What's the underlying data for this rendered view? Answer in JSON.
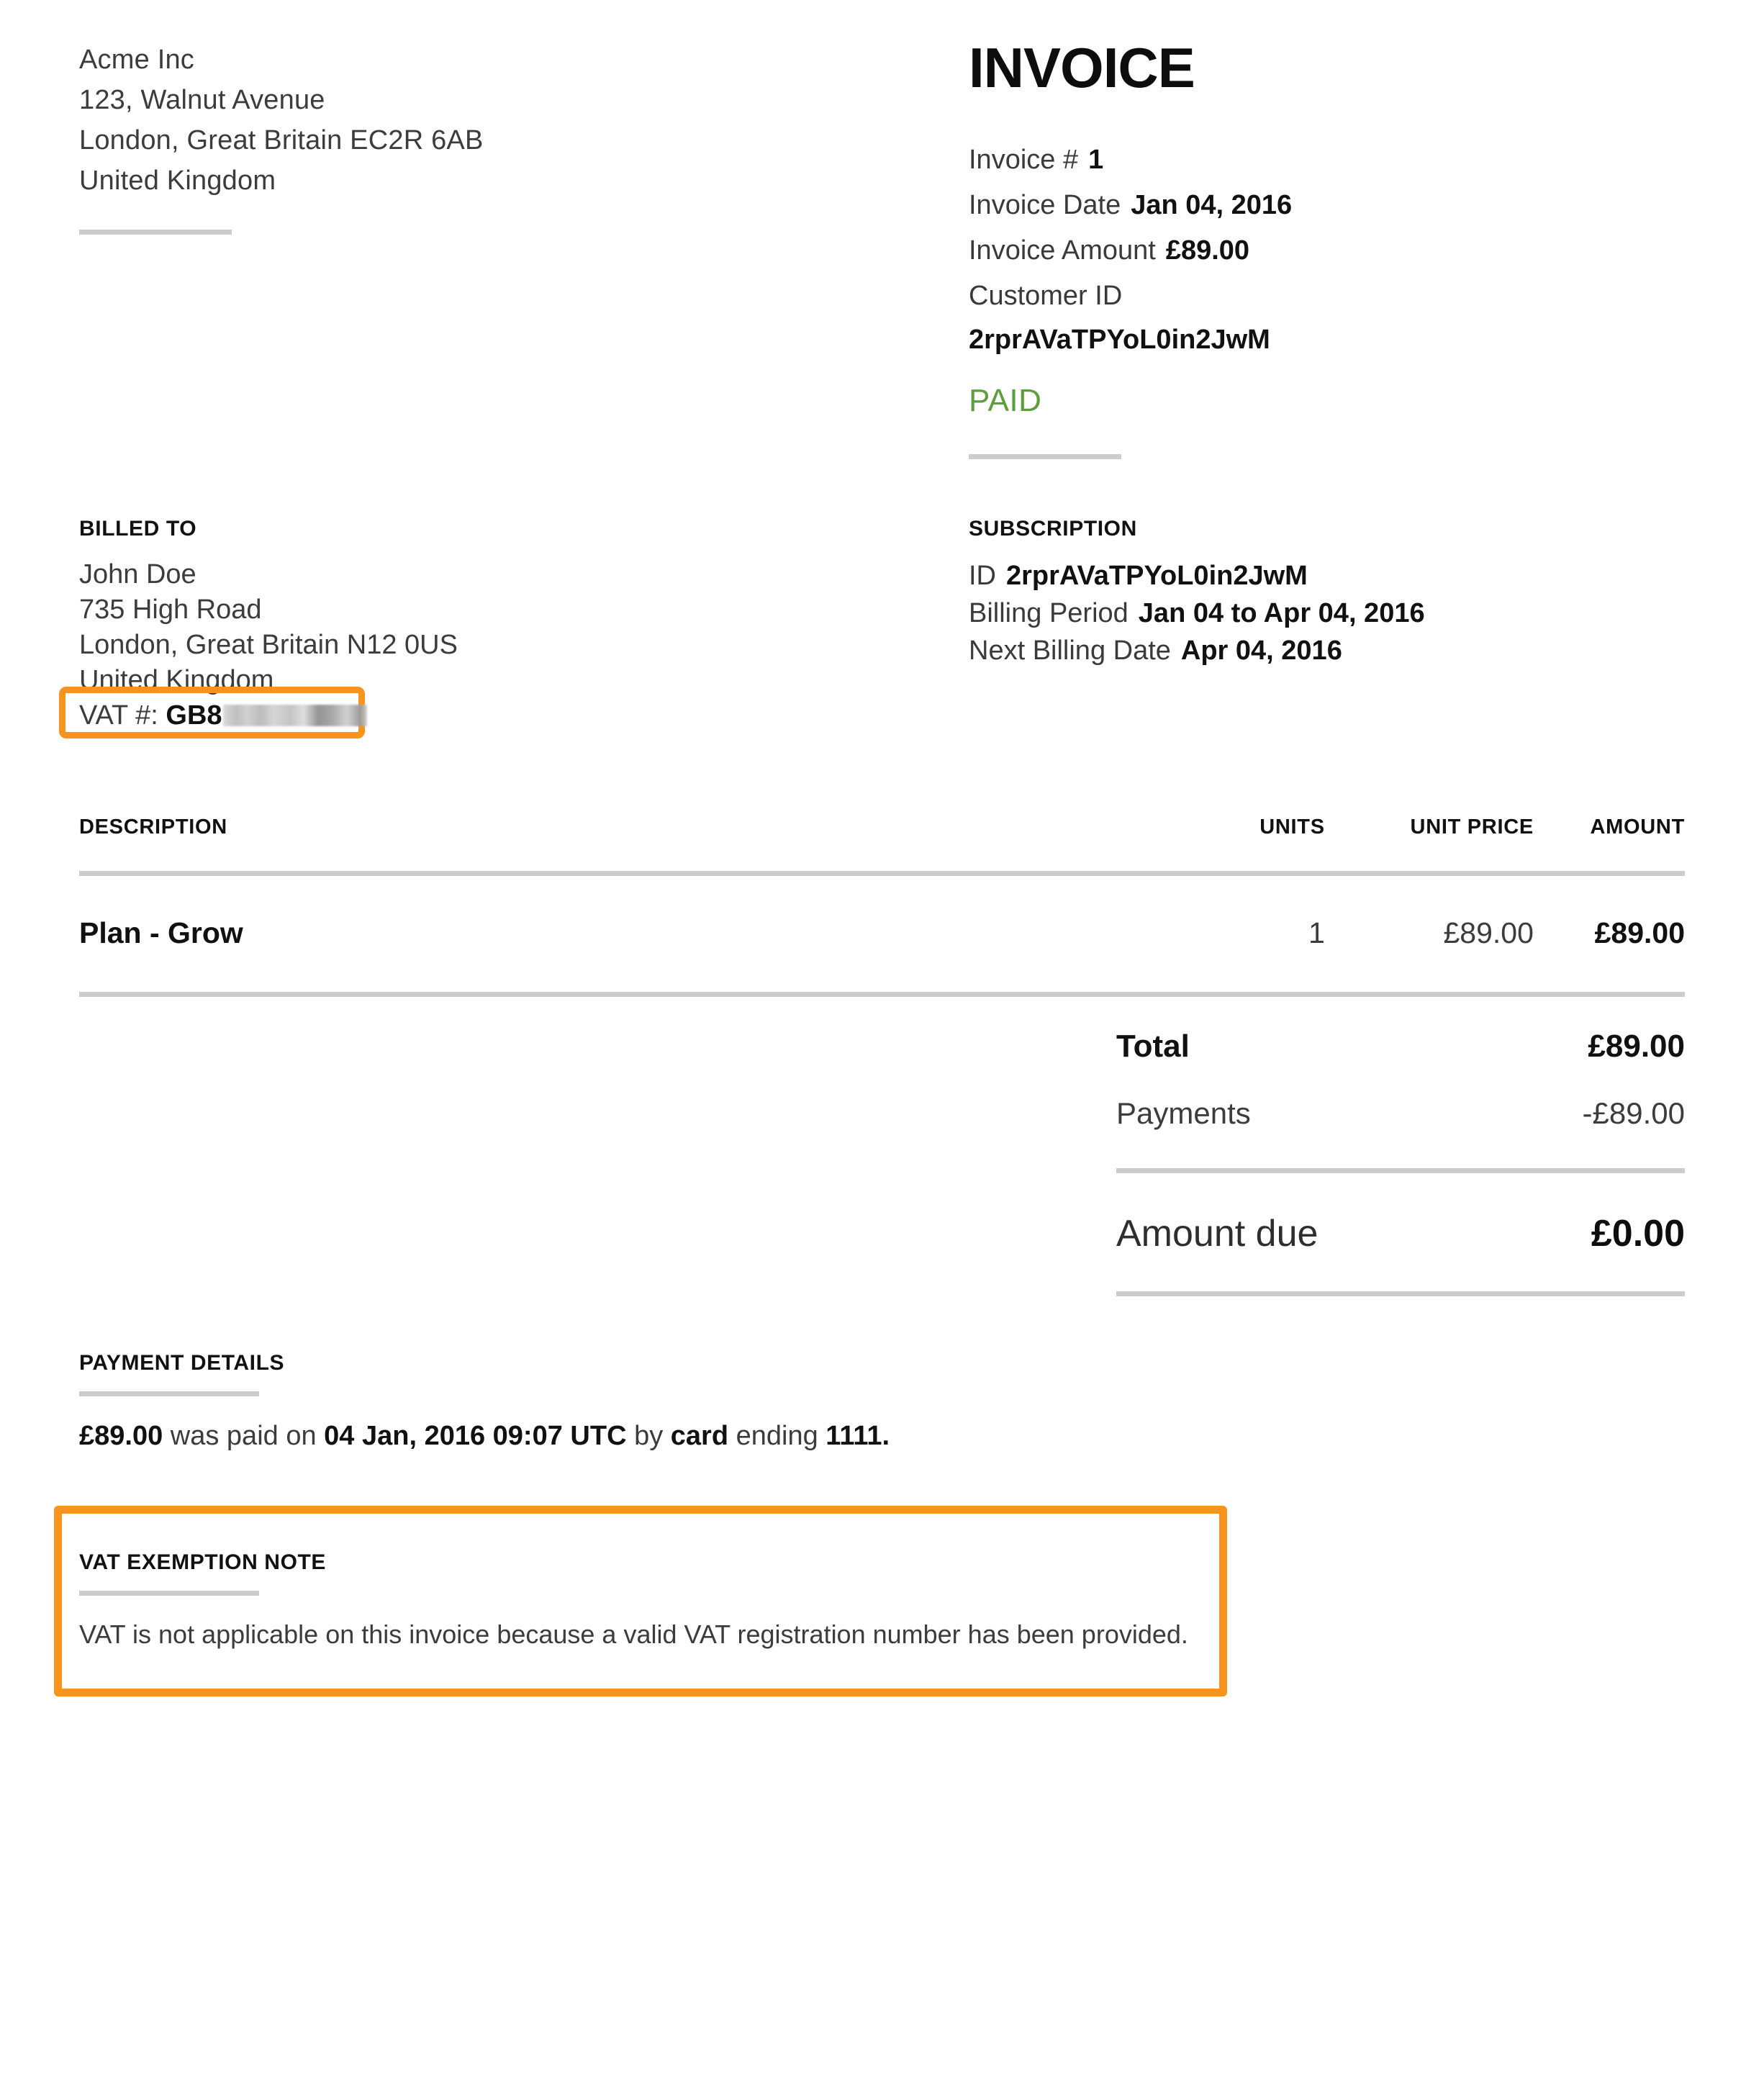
{
  "document": {
    "title": "INVOICE"
  },
  "sender": {
    "lines": [
      "Acme Inc",
      "123, Walnut Avenue",
      "London, Great Britain EC2R 6AB",
      "United Kingdom"
    ]
  },
  "invoice_meta": {
    "number_label": "Invoice #",
    "number_value": "1",
    "date_label": "Invoice Date",
    "date_value": "Jan 04, 2016",
    "amount_label": "Invoice Amount",
    "amount_value": "£89.00",
    "customer_id_label": "Customer ID",
    "customer_id_value": "2rprAVaTPYoL0in2JwM",
    "status": "PAID",
    "status_color": "#5d9e3c"
  },
  "billed_to": {
    "heading": "BILLED TO",
    "lines": [
      "John Doe",
      "735 High Road",
      "London, Great Britain N12 0US",
      "United Kingdom"
    ],
    "vat_label": "VAT #:",
    "vat_value_visible": "GB8",
    "vat_value_redacted": true,
    "highlight_color": "#f7941e"
  },
  "subscription": {
    "heading": "SUBSCRIPTION",
    "id_label": "ID",
    "id_value": "2rprAVaTPYoL0in2JwM",
    "billing_period_label": "Billing Period",
    "billing_period_value": "Jan 04 to Apr 04, 2016",
    "next_billing_label": "Next Billing Date",
    "next_billing_value": "Apr 04, 2016"
  },
  "items_table": {
    "columns": [
      "DESCRIPTION",
      "UNITS",
      "UNIT PRICE",
      "AMOUNT"
    ],
    "rows": [
      {
        "description": "Plan - Grow",
        "units": "1",
        "unit_price": "£89.00",
        "amount": "£89.00"
      }
    ]
  },
  "totals": {
    "total_label": "Total",
    "total_value": "£89.00",
    "payments_label": "Payments",
    "payments_value": "-£89.00",
    "due_label": "Amount due",
    "due_value": "£0.00"
  },
  "payment_details": {
    "heading": "PAYMENT DETAILS",
    "amount": "£89.00",
    "text_1": " was paid on ",
    "datetime": "04 Jan, 2016 09:07 UTC",
    "text_2": " by ",
    "method": "card",
    "text_3": " ending ",
    "card_last4": "1111."
  },
  "vat_note": {
    "heading": "VAT EXEMPTION NOTE",
    "body": "VAT is not applicable on this invoice because a valid VAT registration number has been provided.",
    "highlight_color": "#f7941e"
  }
}
